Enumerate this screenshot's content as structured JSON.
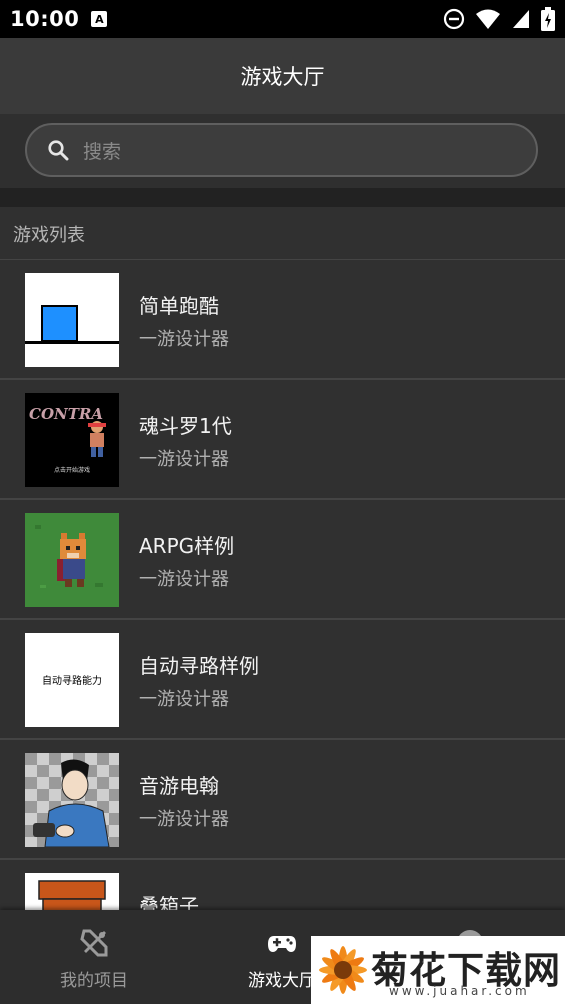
{
  "status_bar": {
    "time": "10:00",
    "notification_badge": "A",
    "icons": [
      "do-not-disturb-icon",
      "wifi-icon",
      "cell-signal-icon",
      "battery-icon"
    ]
  },
  "app_bar": {
    "title": "游戏大厅"
  },
  "search": {
    "placeholder": "搜索",
    "icon": "search-icon"
  },
  "list": {
    "header": "游戏列表",
    "items": [
      {
        "title": "简单跑酷",
        "subtitle": "一游设计器",
        "thumb": "blue-square-runner"
      },
      {
        "title": "魂斗罗1代",
        "subtitle": "一游设计器",
        "thumb": "contra-title",
        "thumb_logo": "CONTRA",
        "thumb_caption": "点击开始游戏"
      },
      {
        "title": "ARPG样例",
        "subtitle": "一游设计器",
        "thumb": "pixel-fox-on-grass"
      },
      {
        "title": "自动寻路样例",
        "subtitle": "一游设计器",
        "thumb": "white-text-card",
        "thumb_caption": "自动寻路能力"
      },
      {
        "title": "音游电翰",
        "subtitle": "一游设计器",
        "thumb": "drawn-character-checkerboard"
      },
      {
        "title": "叠箱子",
        "subtitle": "",
        "thumb": "orange-boxes"
      }
    ]
  },
  "bottom_nav": {
    "items": [
      {
        "label": "我的项目",
        "icon": "design-tools-icon",
        "active": false
      },
      {
        "label": "游戏大厅",
        "icon": "gamepad-icon",
        "active": true
      },
      {
        "label": "",
        "icon": "profile-icon",
        "active": false
      }
    ]
  },
  "watermark": {
    "text": "菊花下载网",
    "url": "www.juahar.com"
  },
  "colors": {
    "status_bar": "#000000",
    "app_bar": "#3a3a3a",
    "list_background": "#303030",
    "thumb_blue": "#1e90ff",
    "nav_inactive": "#9a9a9a",
    "nav_active": "#ffffff"
  }
}
